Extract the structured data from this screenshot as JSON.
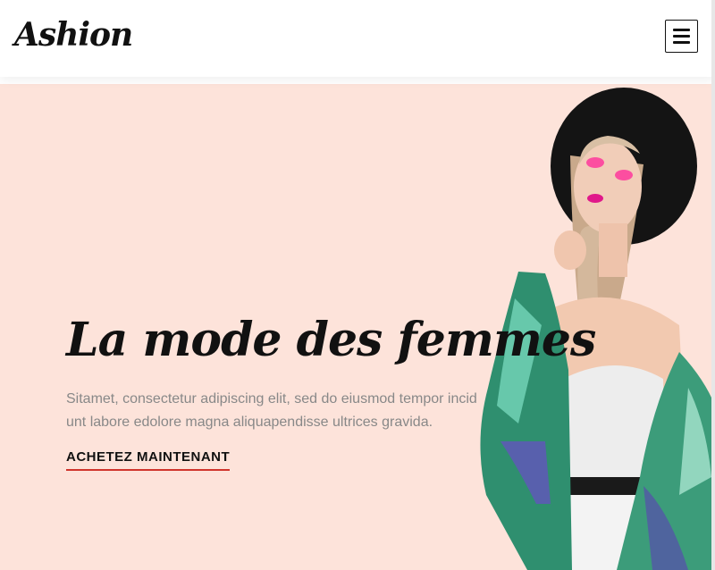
{
  "header": {
    "logo": "Ashion",
    "menu_icon": "hamburger-menu-icon"
  },
  "hero": {
    "title": "La mode des femmes",
    "description": "Sitamet, consectetur adipiscing elit, sed do eiusmod tempor incid unt labore edolore magna aliquapendisse ultrices gravida.",
    "cta_label": "ACHETEZ MAINTENANT",
    "model_image": "woman-fashion-model-image"
  },
  "colors": {
    "hero_background": "#fde3da",
    "accent_underline": "#d0342c",
    "text_dark": "#111111",
    "text_muted": "#888888"
  }
}
